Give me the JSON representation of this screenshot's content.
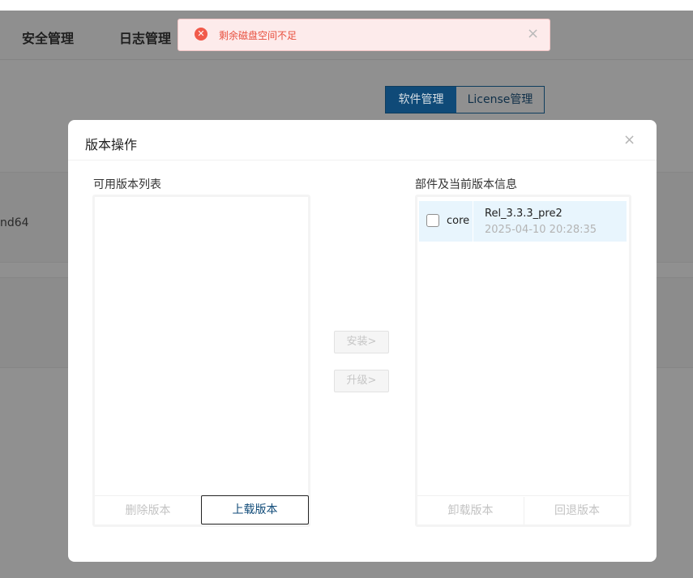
{
  "background": {
    "nav": [
      "安全管理",
      "日志管理"
    ],
    "tabs": [
      {
        "label": "软件管理",
        "active": true
      },
      {
        "label": "License管理",
        "active": false
      }
    ],
    "row_text": "nd64"
  },
  "toast": {
    "type": "error",
    "icon": "error-circle-icon",
    "message": "剩余磁盘空间不足",
    "close_glyph": "×"
  },
  "modal": {
    "title": "版本操作",
    "close_glyph": "×",
    "available": {
      "title": "可用版本列表",
      "items": [],
      "delete_label": "删除版本",
      "upload_label": "上载版本"
    },
    "actions": {
      "install_label": "安装>",
      "upgrade_label": "升级>"
    },
    "components": {
      "title": "部件及当前版本信息",
      "items": [
        {
          "name": "core",
          "version": "Rel_3.3.3_pre2",
          "time": "2025-04-10 20:28:35",
          "checked": false
        }
      ],
      "uninstall_label": "卸载版本",
      "rollback_label": "回退版本"
    }
  },
  "colors": {
    "accent": "#0f4a78",
    "error": "#f15a4a",
    "selected_row": "#e8f5fd"
  }
}
